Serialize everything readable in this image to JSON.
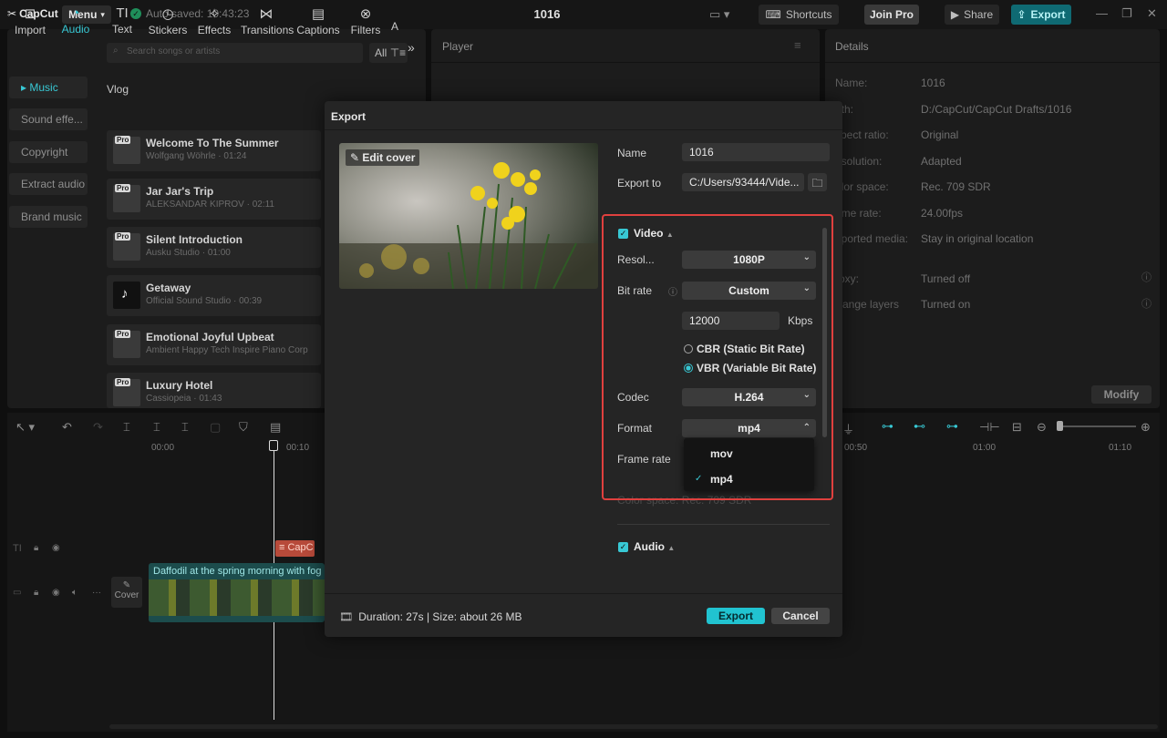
{
  "titlebar": {
    "logo": "CapCut",
    "menu_label": "Menu",
    "autosave": "Auto saved: 10:43:23",
    "project_title": "1016",
    "shortcuts_label": "Shortcuts",
    "joinpro_label": "Join Pro",
    "share_label": "Share",
    "export_label": "Export"
  },
  "tabs": [
    {
      "label": "Import",
      "icon": "import-icon"
    },
    {
      "label": "Audio",
      "icon": "audio-icon"
    },
    {
      "label": "Text",
      "icon": "text-icon"
    },
    {
      "label": "Stickers",
      "icon": "stickers-icon"
    },
    {
      "label": "Effects",
      "icon": "effects-icon"
    },
    {
      "label": "Transitions",
      "icon": "transitions-icon"
    },
    {
      "label": "Captions",
      "icon": "captions-icon"
    },
    {
      "label": "Filters",
      "icon": "filters-icon"
    },
    {
      "label": "A"
    }
  ],
  "sidebar": {
    "items": [
      "Music",
      "Sound effe...",
      "Copyright",
      "Extract audio",
      "Brand music"
    ]
  },
  "audio": {
    "search_placeholder": "Search songs or artists",
    "filter_label": "All",
    "section": "Vlog",
    "tracks": [
      {
        "title": "Welcome To The Summer",
        "sub": "Wolfgang Wöhrle · 01:24"
      },
      {
        "title": "Jar Jar's Trip",
        "sub": "ALEKSANDAR KIPROV · 02:11"
      },
      {
        "title": "Silent Introduction",
        "sub": "Ausku Studio · 01:00"
      },
      {
        "title": "Getaway",
        "sub": "Official Sound Studio · 00:39"
      },
      {
        "title": "Emotional Joyful Upbeat",
        "sub": "Ambient Happy Tech Inspire Piano Corp"
      },
      {
        "title": "Luxury Hotel",
        "sub": "Cassiopeia · 01:43"
      }
    ],
    "pro_badge": "Pro"
  },
  "player": {
    "title": "Player"
  },
  "details": {
    "title": "Details",
    "rows": [
      {
        "key": "Name:",
        "value": "1016"
      },
      {
        "key": "ath:",
        "value": "D:/CapCut/CapCut Drafts/1016"
      },
      {
        "key": "spect ratio:",
        "value": "Original"
      },
      {
        "key": "esolution:",
        "value": "Adapted"
      },
      {
        "key": "olor space:",
        "value": "Rec. 709 SDR"
      },
      {
        "key": "ame rate:",
        "value": "24.00fps"
      },
      {
        "key": "nported media:",
        "value": "Stay in original location"
      },
      {
        "key": "roxy:",
        "value": "Turned off"
      },
      {
        "key": "rrange layers",
        "value": "Turned on"
      }
    ],
    "modify_label": "Modify"
  },
  "timeline": {
    "ruler": [
      "00:00",
      "00:10",
      "00:50",
      "01:00",
      "01:10"
    ],
    "clip_label": "Daffodil at the spring morning with fog",
    "caption_chip": "CapC",
    "cover_label": "Cover"
  },
  "dialog": {
    "title": "Export",
    "edit_cover": "Edit cover",
    "name_label": "Name",
    "name_value": "1016",
    "export_to_label": "Export to",
    "export_to_value": "C:/Users/93444/Vide...",
    "video_label": "Video",
    "resolution_label": "Resol...",
    "resolution_value": "1080P",
    "bitrate_label": "Bit rate",
    "bitrate_mode": "Custom",
    "bitrate_value": "12000",
    "bitrate_unit": "Kbps",
    "cbr_label": "CBR (Static Bit Rate)",
    "vbr_label": "VBR (Variable Bit Rate)",
    "codec_label": "Codec",
    "codec_value": "H.264",
    "format_label": "Format",
    "format_value": "mp4",
    "format_options": [
      "mov",
      "mp4"
    ],
    "framerate_label": "Frame rate",
    "colorspace_ghost": "Color space: Rec. 709 SDR",
    "audio_label": "Audio",
    "duration": "Duration: 27s | Size: about 26 MB",
    "export_btn": "Export",
    "cancel_btn": "Cancel"
  },
  "colors": {
    "accent": "#38c8d4",
    "highlight": "#e0403e"
  }
}
